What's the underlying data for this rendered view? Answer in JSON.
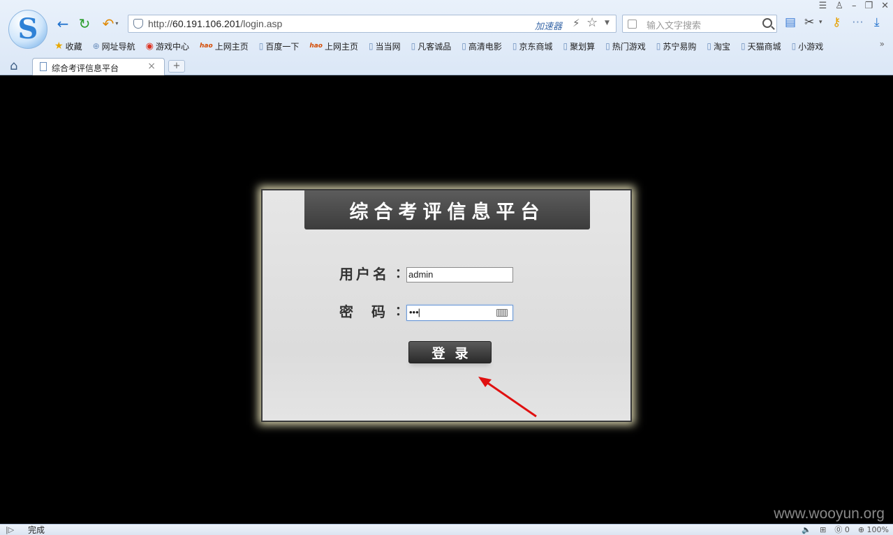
{
  "browser": {
    "address": {
      "url_prefix": "http://",
      "url_host": "60.191.106.201",
      "url_path": "/login.asp",
      "accelerator_label": "加速器"
    },
    "search": {
      "placeholder": "输入文字搜索"
    },
    "bookmarks": [
      {
        "label": "收藏",
        "icon": "star-icon"
      },
      {
        "label": "网址导航",
        "icon": "globe-icon"
      },
      {
        "label": "游戏中心",
        "icon": "game-icon"
      },
      {
        "label": "上网主页",
        "icon": "hao-icon",
        "badge": "hao"
      },
      {
        "label": "百度一下",
        "icon": "page-icon"
      },
      {
        "label": "上网主页",
        "icon": "hao-icon",
        "badge": "hao"
      },
      {
        "label": "当当网",
        "icon": "page-icon"
      },
      {
        "label": "凡客诚品",
        "icon": "page-icon"
      },
      {
        "label": "高清电影",
        "icon": "page-icon"
      },
      {
        "label": "京东商城",
        "icon": "page-icon"
      },
      {
        "label": "聚划算",
        "icon": "page-icon"
      },
      {
        "label": "热门游戏",
        "icon": "page-icon"
      },
      {
        "label": "苏宁易购",
        "icon": "page-icon"
      },
      {
        "label": "淘宝",
        "icon": "page-icon"
      },
      {
        "label": "天猫商城",
        "icon": "page-icon"
      },
      {
        "label": "小游戏",
        "icon": "page-icon"
      }
    ],
    "tab": {
      "title": "综合考评信息平台"
    },
    "status": {
      "text": "完成",
      "zoom": "100%",
      "count": "0"
    }
  },
  "login": {
    "title": "综合考评信息平台",
    "username_label": "用户名",
    "password_label": "密码",
    "colon": "：",
    "username_value": "admin",
    "password_value": "•••",
    "submit_label": "登录"
  },
  "watermark": "www.wooyun.org",
  "colors": {
    "annotation_arrow": "#e01010",
    "chrome_bg": "#e3ecf8",
    "panel_bg": "#e2e2e2"
  }
}
